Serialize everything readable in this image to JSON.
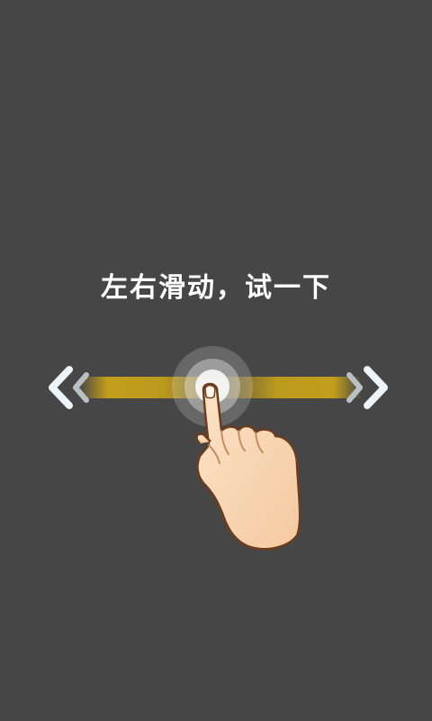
{
  "guide": {
    "hint_text": "左右滑动，试一下"
  },
  "icons": {
    "left": "chevron-left-icon",
    "right": "chevron-right-icon",
    "hand": "pointing-hand-icon",
    "touch": "touch-ripple-icon"
  },
  "colors": {
    "background": "#464646",
    "track": "#C9A31A",
    "chevron_outer": "#EDF5FB",
    "chevron_inner": "#B9C0C6",
    "text": "#FFFFFF"
  }
}
